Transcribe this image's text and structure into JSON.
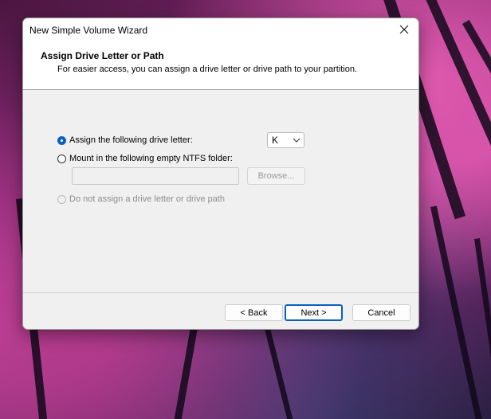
{
  "window": {
    "title": "New Simple Volume Wizard"
  },
  "header": {
    "title": "Assign Drive Letter or Path",
    "subtitle": "For easier access, you can assign a drive letter or drive path to your partition."
  },
  "options": {
    "assign_letter": {
      "label": "Assign the following drive letter:",
      "checked": true
    },
    "mount_folder": {
      "label": "Mount in the following empty NTFS folder:",
      "checked": false
    },
    "no_assign": {
      "label": "Do not assign a drive letter or drive path",
      "checked": false,
      "disabled": true
    }
  },
  "drive_letter": {
    "selected": "K"
  },
  "folder_path": {
    "value": ""
  },
  "buttons": {
    "browse": "Browse...",
    "back": "< Back",
    "next": "Next >",
    "cancel": "Cancel"
  },
  "colors": {
    "accent": "#0a5fbf",
    "dialog_bg": "#f0f0f0",
    "header_bg": "#ffffff"
  },
  "icons": {
    "close": "close-icon",
    "dropdown": "chevron-down-icon"
  }
}
